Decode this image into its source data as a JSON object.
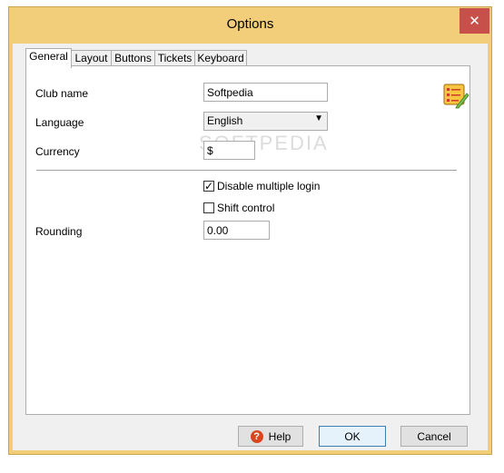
{
  "window": {
    "title": "Options",
    "close_glyph": "✕"
  },
  "tabs": [
    "General",
    "Layout",
    "Buttons",
    "Tickets",
    "Keyboard"
  ],
  "general": {
    "club_name_label": "Club name",
    "club_name_value": "Softpedia",
    "language_label": "Language",
    "language_value": "English",
    "currency_label": "Currency",
    "currency_value": "$",
    "disable_multiple_login": {
      "label": "Disable multiple login",
      "checked": true
    },
    "shift_control": {
      "label": "Shift control",
      "checked": false
    },
    "rounding_label": "Rounding",
    "rounding_value": "0.00"
  },
  "buttons": {
    "help": "Help",
    "ok": "OK",
    "cancel": "Cancel"
  },
  "watermark": "SOFTPEDIA",
  "icons": {
    "options": "checklist-pencil-icon",
    "help": "help-icon",
    "dropdown": "chevron-down-icon",
    "close": "close-icon"
  }
}
